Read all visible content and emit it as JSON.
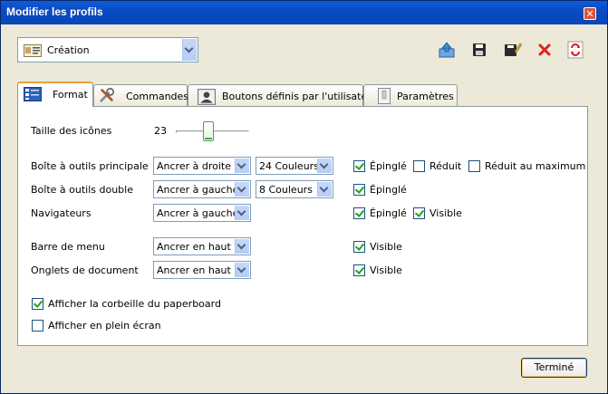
{
  "window": {
    "title": "Modifier les profils"
  },
  "profile": {
    "selected": "Création"
  },
  "tabs": [
    {
      "label": "Format",
      "icon": "format-icon"
    },
    {
      "label": "Commandes",
      "icon": "tools-icon"
    },
    {
      "label": "Boutons définis par l'utilisateur",
      "icon": "user-card-icon"
    },
    {
      "label": "Paramètres",
      "icon": "settings-icon"
    }
  ],
  "format": {
    "icon_size": {
      "label": "Taille des icônes",
      "value": "23"
    },
    "rows": [
      {
        "label": "Boîte à outils principale",
        "position": "Ancrer à droite",
        "colors": "24 Couleurs",
        "checks": [
          {
            "label": "Épinglé",
            "checked": true
          },
          {
            "label": "Réduit",
            "checked": false
          },
          {
            "label": "Réduit au maximum",
            "checked": false
          }
        ]
      },
      {
        "label": "Boîte à outils double",
        "position": "Ancrer à gauche",
        "colors": "8 Couleurs",
        "checks": [
          {
            "label": "Épinglé",
            "checked": true
          }
        ]
      },
      {
        "label": "Navigateurs",
        "position": "Ancrer à gauche",
        "checks": [
          {
            "label": "Épinglé",
            "checked": true
          },
          {
            "label": "Visible",
            "checked": true
          }
        ]
      },
      {
        "label": "Barre de menu",
        "position": "Ancrer en haut",
        "checks": [
          {
            "label": "Visible",
            "checked": true
          }
        ]
      },
      {
        "label": "Onglets de document",
        "position": "Ancrer en haut",
        "checks": [
          {
            "label": "Visible",
            "checked": true
          }
        ]
      }
    ],
    "options": [
      {
        "label": "Afficher la corbeille du paperboard",
        "checked": true
      },
      {
        "label": "Afficher en plein écran",
        "checked": false
      }
    ]
  },
  "buttons": {
    "done": "Terminé"
  },
  "toolbar_icons": [
    "export-icon",
    "save-icon",
    "save-edit-icon",
    "delete-icon",
    "reset-icon"
  ]
}
